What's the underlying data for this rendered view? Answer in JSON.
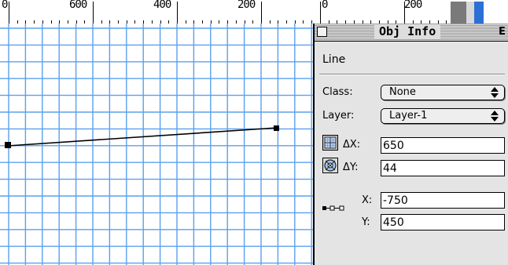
{
  "ruler": {
    "main_labels": [
      "0",
      "600",
      "400",
      "200"
    ],
    "right_labels": [
      "0",
      "200"
    ]
  },
  "palette": {
    "title": "Obj Info",
    "zoom_glyph": "E",
    "object_type": "Line",
    "class_label": "Class:",
    "class_value": "None",
    "layer_label": "Layer:",
    "layer_value": "Layer-1",
    "dx_label": "ΔX:",
    "dx_value": "650",
    "dy_label": "ΔY:",
    "dy_value": "44",
    "x_label": "X:",
    "x_value": "-750",
    "y_label": "Y:",
    "y_value": "450"
  },
  "colors": {
    "grid_blue": "#5aa0ee",
    "accent_blue": "#2e6fd6"
  },
  "icons": {
    "close_box": "close-box-icon",
    "popup_arrows": "up-down-arrows-icon",
    "delta_grid": "grid-icon",
    "delta_target": "target-icon",
    "endpoints": "line-endpoints-icon"
  }
}
